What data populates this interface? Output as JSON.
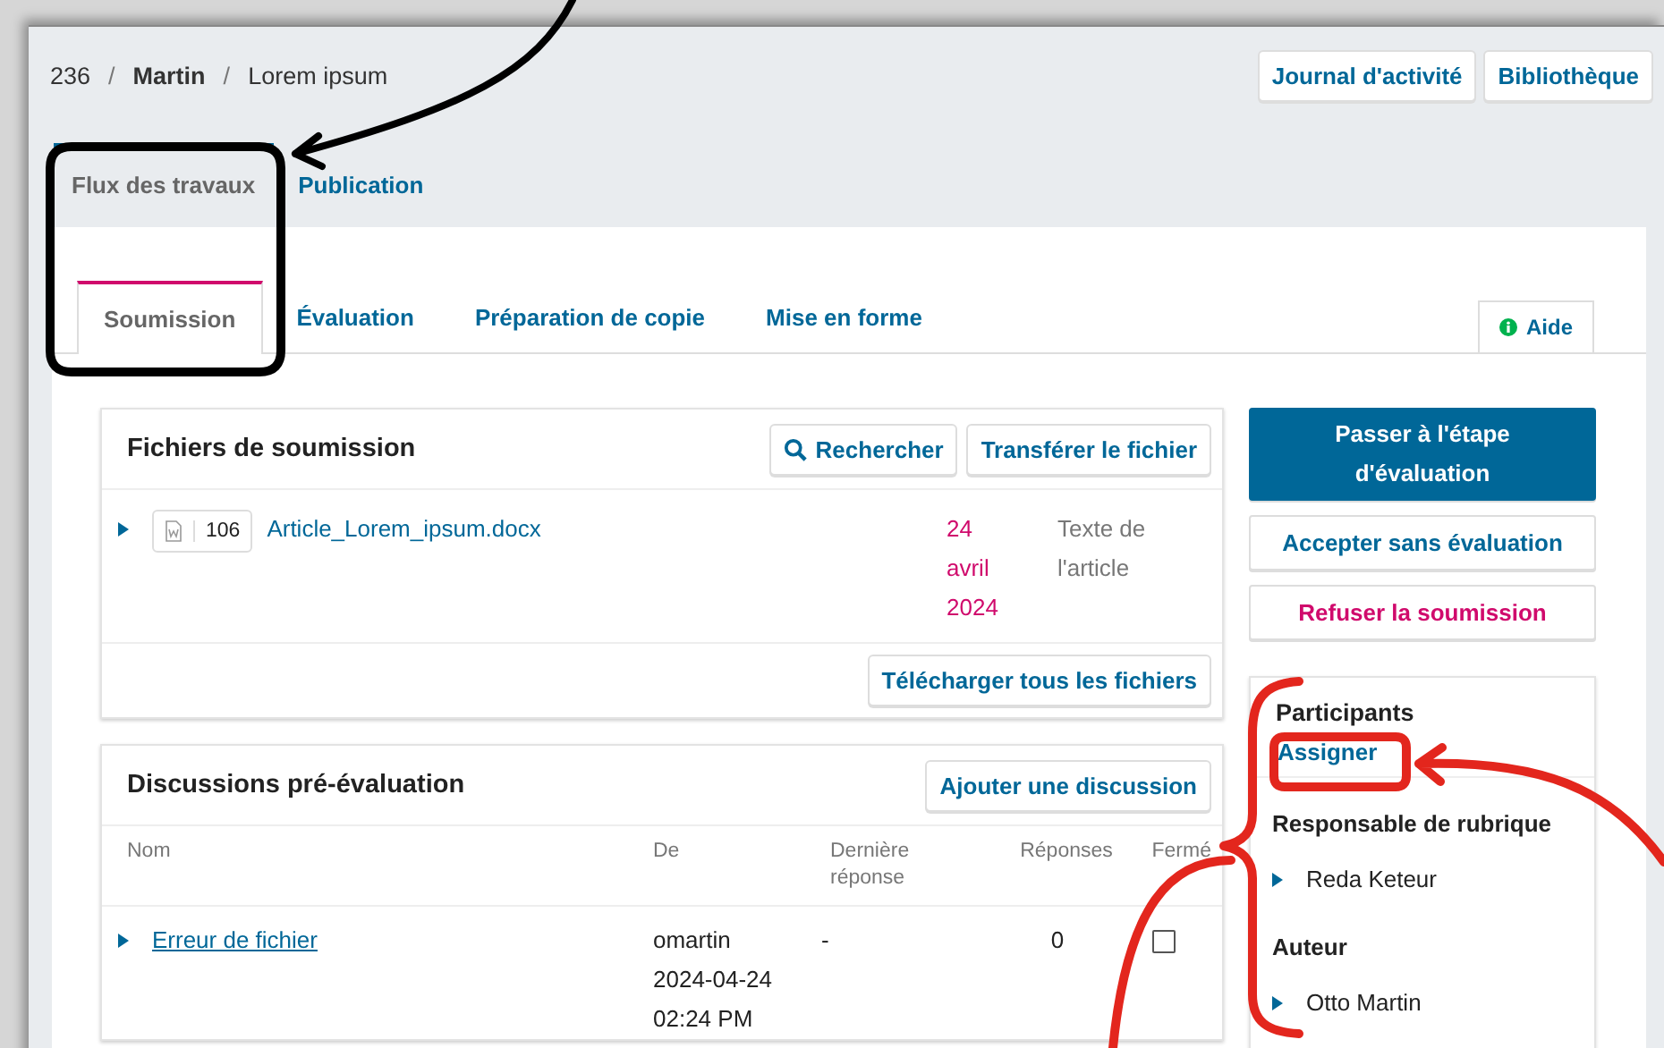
{
  "breadcrumb": [
    {
      "text": "236",
      "kind": "plain"
    },
    {
      "text": "/",
      "kind": "separator"
    },
    {
      "text": "Martin",
      "kind": "strong"
    },
    {
      "text": "/",
      "kind": "separator"
    },
    {
      "text": "Lorem ipsum",
      "kind": "plain"
    }
  ],
  "header_buttons": [
    "Journal d'activité",
    "Bibliothèque"
  ],
  "main_tabs": [
    {
      "label": "Flux des travaux",
      "selected": true
    },
    {
      "label": "Publication",
      "selected": false
    }
  ],
  "stage_tabs": [
    {
      "label": "Soumission",
      "selected": true
    },
    {
      "label": "Évaluation",
      "selected": false
    },
    {
      "label": "Préparation de copie",
      "selected": false
    },
    {
      "label": "Mise en forme",
      "selected": false
    }
  ],
  "help_button": "Aide",
  "files_panel": {
    "title": "Fichiers de soumission",
    "buttons": [
      {
        "label": "Rechercher",
        "kind": "search"
      },
      {
        "label": "Transférer le fichier",
        "kind": "plain"
      }
    ],
    "files": [
      {
        "id": "106",
        "name": "Article_Lorem_ipsum.docx",
        "date": "24 avril 2024",
        "type": "Texte de l'article"
      }
    ],
    "footer_button": "Télécharger tous les fichiers"
  },
  "discussions_panel": {
    "title": "Discussions pré-évaluation",
    "add_button": "Ajouter une discussion",
    "columns": [
      "Nom",
      "De",
      "Dernière réponse",
      "Réponses",
      "Fermé"
    ],
    "rows": [
      {
        "name": "Erreur de fichier",
        "from": [
          "omartin",
          "2024-04-24",
          "02:24 PM"
        ],
        "last_reply": "-",
        "replies": "0",
        "closed": false
      }
    ]
  },
  "actions": [
    {
      "label": "Passer à l'étape d'évaluation",
      "kind": "primary"
    },
    {
      "label": "Accepter sans évaluation",
      "kind": "accept"
    },
    {
      "label": "Refuser la soumission",
      "kind": "decline"
    }
  ],
  "participants": {
    "title": "Participants",
    "assign_button": "Assigner",
    "groups": [
      {
        "title": "Responsable de rubrique",
        "members": [
          "Reda Keteur"
        ]
      },
      {
        "title": "Auteur",
        "members": [
          "Otto Martin"
        ]
      }
    ]
  },
  "annotations": [
    {
      "kind": "frame",
      "color": "#000000"
    },
    {
      "kind": "arrow",
      "color": "#000000"
    },
    {
      "kind": "frame",
      "color": "#e3261d"
    },
    {
      "kind": "arrow",
      "color": "#e3261d"
    },
    {
      "kind": "brace",
      "color": "#e3261d"
    }
  ]
}
